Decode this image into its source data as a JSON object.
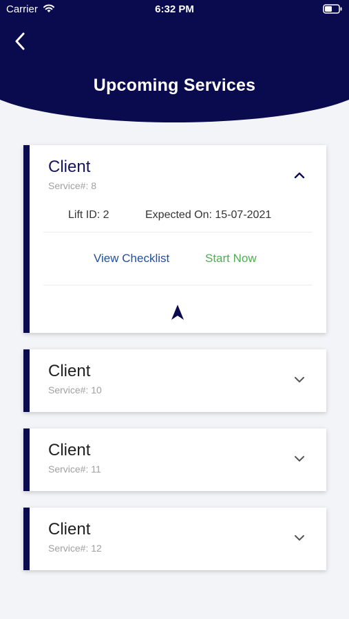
{
  "status_bar": {
    "carrier": "Carrier",
    "time": "6:32 PM"
  },
  "header": {
    "title": "Upcoming Services",
    "back_icon": "chevron-left-icon"
  },
  "colors": {
    "primary": "#0a0b4f",
    "link_blue": "#1f4e9c",
    "start_green": "#4caf50",
    "background": "#f3f4f8"
  },
  "services": [
    {
      "client": "Client",
      "service_no": "Service#: 8",
      "expanded": true,
      "lift_id": "Lift ID: 2",
      "expected_on": "Expected On: 15-07-2021",
      "view_checklist": "View Checklist",
      "start_now": "Start Now",
      "chevron": "chevron-up-icon"
    },
    {
      "client": "Client",
      "service_no": "Service#: 10",
      "expanded": false,
      "chevron": "chevron-down-icon"
    },
    {
      "client": "Client",
      "service_no": "Service#: 11",
      "expanded": false,
      "chevron": "chevron-down-icon"
    },
    {
      "client": "Client",
      "service_no": "Service#: 12",
      "expanded": false,
      "chevron": "chevron-down-icon"
    }
  ]
}
